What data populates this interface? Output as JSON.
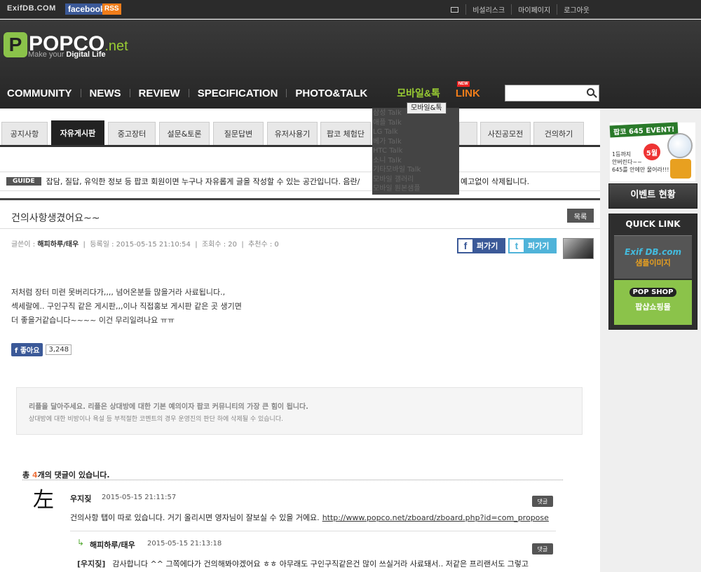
{
  "topbar": {
    "exif_logo": "ExifDB.COM",
    "facebook": "facebook",
    "rss": "RSS",
    "links": [
      "비설리스크",
      "마이페이지",
      "로그아웃"
    ]
  },
  "brand": {
    "name": "POPCO",
    "suffix": ".net",
    "slogan_pre": "Make your",
    "slogan_bold": "Digital Life"
  },
  "nav": {
    "items": [
      "COMMUNITY",
      "NEWS",
      "REVIEW",
      "SPECIFICATION",
      "PHOTO&TALK"
    ],
    "mobile": "모바일&톡",
    "link": "LINK",
    "new_badge": "NEW"
  },
  "search": {
    "placeholder": ""
  },
  "tabs": [
    "공지사항",
    "자유게시판",
    "중고장터",
    "설문&토론",
    "질문답변",
    "유저사용기",
    "팝코 체험단",
    "",
    "",
    "",
    "사진공모전",
    "건의하기"
  ],
  "mobile_menu": {
    "tooltip": "모바일&톡",
    "items": [
      "삼성 Talk",
      "애플 Talk",
      "LG Talk",
      "베가 Talk",
      "HTC Talk",
      "소니 Talk",
      "기타모바일 Talk",
      "모바일 갤러리",
      "모바일 원본샘플"
    ]
  },
  "guide": {
    "badge": "GUIDE",
    "text": "잡담, 질답, 유익한 정보 등 팝코 회원이면 누구나 자유롭게 글을 작성할 수 있는 공간입니다. 음란/",
    "text2": "예고없이 삭제됩니다."
  },
  "post": {
    "title": "건의사항생겼어요~~",
    "list_button": "목록",
    "meta": {
      "author_label": "글쓴이 :",
      "author": "해피하루/태우",
      "date_label": "등록일 : 2015-05-15 21:10:54",
      "views_label": "조회수 : 20",
      "recommend_label": "추천수 : 0"
    },
    "share_fb": "퍼가기",
    "share_tw": "퍼가기",
    "body": [
      "저처럼 장터 미련 못버리다가,,,, 넘어온분들 많을거라 사료됩니다.,",
      "섹세랄에.. 구인구직 같은 게시판,,,이나 직접홍보 게시판 같은 곳 생기면",
      "더 좋을거같습니다~~~~ 이건 무리일려나요 ㅠㅠ"
    ],
    "like": "좋아요",
    "like_count": "3,248"
  },
  "notice": {
    "title": "리플을 달아주세요. 리플은 상대방에 대한 기본 예의이자 팝코 커뮤니티의 가장 큰 힘이 됩니다.",
    "sub": "상대방에 대한 비방이나 욕설 등 부적절한 코멘트의 경우 운영진의 판단 하에 삭제될 수 있습니다."
  },
  "comments": {
    "head_pre": "총 ",
    "count": "4",
    "head_post": "개의 댓글이 있습니다.",
    "reply_label": "댓글",
    "items": [
      {
        "name": "우지짖",
        "date": "2015-05-15 21:11:57",
        "text": "건의사항 탭이 따로 있습니다. 거기 올리시면 영자님이 잘보실 수 있을 거에요.",
        "url": "http://www.popco.net/zboard/zboard.php?id=com_propose"
      },
      {
        "name": "해피하루/태우",
        "date": "2015-05-15 21:13:18",
        "mention": "[우지짖]",
        "text": "감사합니다 ^^ 그쪽에다가 건의해봐야겠어요 ㅎㅎ 아무래도 구인구직같은건 많이 쓰실거라 사료돼서.. 저같은 프리랜서도 그렇고"
      }
    ]
  },
  "sidebar": {
    "event_title": "팝코 645 EVENT!",
    "event_month": "5월",
    "event_sub": "1등까지\n안버린다~~\n645를 안에만 물어라!!!",
    "event_status": "이벤트 현황",
    "quick_link": "QUICK LINK",
    "exif_title": "Exif DB.com",
    "exif_sub": "샘플이미지",
    "pop_title": "POP SHOP",
    "pop_sub": "팝샵쇼핑몰"
  }
}
